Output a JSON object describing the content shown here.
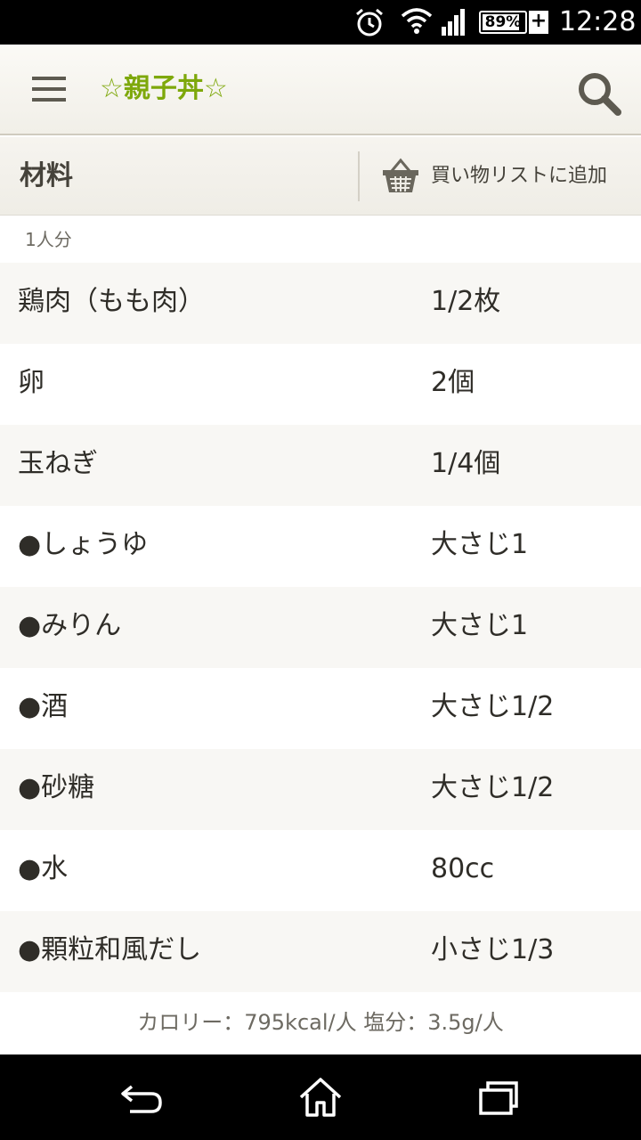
{
  "status_bar": {
    "battery_percent": "89%",
    "battery_level": 0.89,
    "time": "12:28",
    "icons": [
      "alarm-icon",
      "wifi-icon",
      "signal-icon",
      "battery-icon",
      "charging-plus-icon"
    ]
  },
  "app_bar": {
    "title": "☆親子丼☆",
    "title_color": "#7ea80b",
    "menu_icon": "hamburger-menu-icon",
    "search_icon": "search-icon"
  },
  "section": {
    "title": "材料",
    "cart_label": "買い物リストに追加",
    "cart_icon": "basket-icon"
  },
  "servings": "1人分",
  "ingredients": [
    {
      "name": "鶏肉（もも肉）",
      "qty": "1/2枚"
    },
    {
      "name": "卵",
      "qty": "2個"
    },
    {
      "name": "玉ねぎ",
      "qty": "1/4個"
    },
    {
      "name": "●しょうゆ",
      "qty": "大さじ1"
    },
    {
      "name": "●みりん",
      "qty": "大さじ1"
    },
    {
      "name": "●酒",
      "qty": "大さじ1/2"
    },
    {
      "name": "●砂糖",
      "qty": "大さじ1/2"
    },
    {
      "name": "●水",
      "qty": "80cc"
    },
    {
      "name": "●顆粒和風だし",
      "qty": "小さじ1/3"
    }
  ],
  "nutrition": "カロリー：795kcal/人 塩分：3.5g/人",
  "nav_bar": {
    "icons": [
      "back-icon",
      "home-icon",
      "recents-icon"
    ]
  }
}
